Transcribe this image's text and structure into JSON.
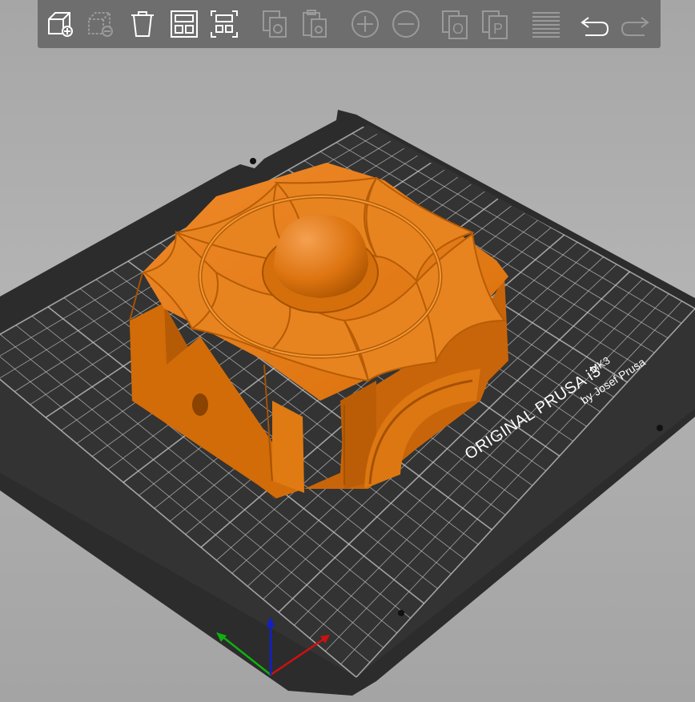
{
  "toolbar": {
    "buttons": [
      {
        "id": "add",
        "icon": "add-object-icon",
        "enabled": true
      },
      {
        "id": "delete",
        "icon": "delete-object-icon",
        "enabled": false
      },
      {
        "id": "delete-all",
        "icon": "trash-icon",
        "enabled": true
      },
      {
        "id": "arrange",
        "icon": "arrange-icon",
        "enabled": true
      },
      {
        "id": "arrange-selection",
        "icon": "arrange-selection-icon",
        "enabled": true
      },
      {
        "id": "copy",
        "icon": "copy-icon",
        "enabled": false
      },
      {
        "id": "paste",
        "icon": "paste-icon",
        "enabled": false
      },
      {
        "id": "add-instance",
        "icon": "plus-circle-icon",
        "enabled": false
      },
      {
        "id": "remove-instance",
        "icon": "minus-circle-icon",
        "enabled": false
      },
      {
        "id": "split-objects",
        "icon": "split-objects-icon",
        "enabled": false
      },
      {
        "id": "split-parts",
        "icon": "split-parts-icon",
        "enabled": false
      },
      {
        "id": "layers-editing",
        "icon": "layers-icon",
        "enabled": false
      },
      {
        "id": "undo",
        "icon": "undo-icon",
        "enabled": true
      },
      {
        "id": "redo",
        "icon": "redo-icon",
        "enabled": false
      }
    ],
    "split_objects_glyph": "O",
    "split_parts_glyph": "P"
  },
  "bed": {
    "brand_line1": "ORIGINAL PRUSA i3",
    "brand_model": "MK3",
    "brand_line2": "by Josef Prusa"
  },
  "colors": {
    "background": "#a9a9a9",
    "toolbar": "#6e6e6e",
    "icon_enabled": "#ffffff",
    "icon_disabled": "#9a9a9a",
    "bed": "#2f2f2f",
    "grid": "#cfcfcf",
    "model": "#e07b10",
    "axis_x": "#d01010",
    "axis_y": "#10b010",
    "axis_z": "#1020d0"
  }
}
